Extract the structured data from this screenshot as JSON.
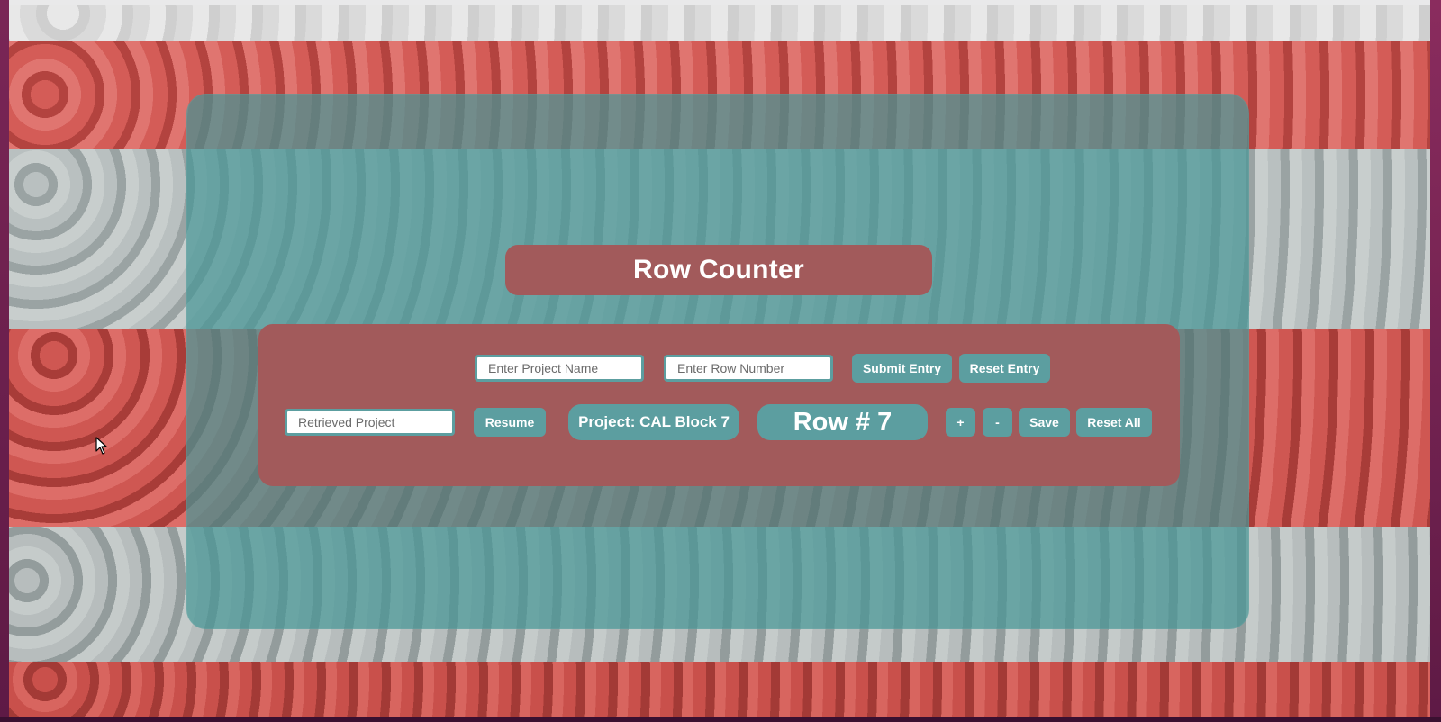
{
  "app": {
    "title": "Row Counter"
  },
  "entry_row": {
    "project_name": {
      "value": "",
      "placeholder": "Enter Project Name"
    },
    "row_number": {
      "value": "",
      "placeholder": "Enter Row Number"
    },
    "submit_label": "Submit Entry",
    "reset_entry_label": "Reset Entry"
  },
  "tracker_row": {
    "retrieved_project": {
      "value": "",
      "placeholder": "Retrieved Project"
    },
    "resume_label": "Resume",
    "project_display": "Project: CAL Block 7",
    "row_display": "Row # 7",
    "increment_label": "+",
    "decrement_label": "-",
    "save_label": "Save",
    "reset_all_label": "Reset All"
  },
  "colors": {
    "panel_teal": "#5c9ea0",
    "panel_rose": "#a25a5b",
    "text_white": "#ffffff"
  },
  "icons": {
    "cursor": "mouse-pointer-icon"
  }
}
